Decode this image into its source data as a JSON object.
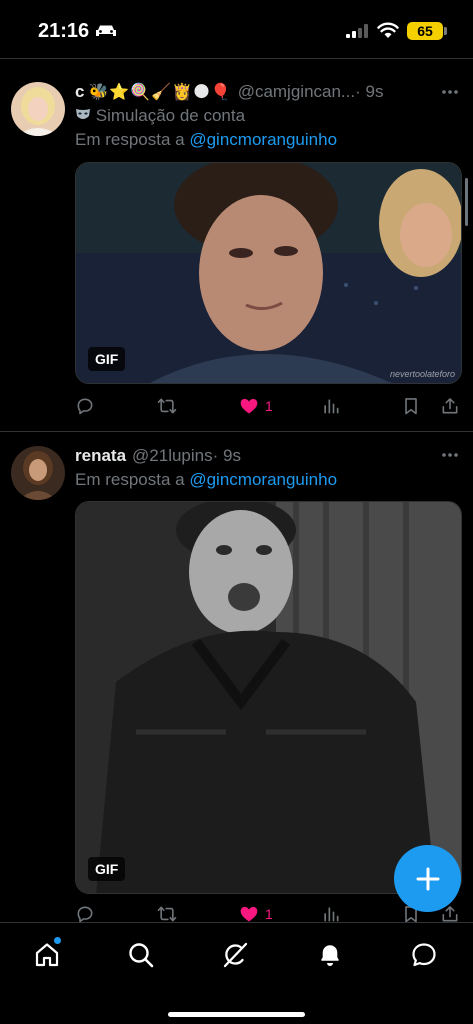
{
  "status_bar": {
    "time": "21:16",
    "battery": "65",
    "icons": [
      "car-icon",
      "cellular-signal-icon",
      "wifi-icon",
      "battery-icon"
    ]
  },
  "tweets": [
    {
      "name": "c",
      "name_emoji": "🐝⭐🍭🧹👸🌑🎈",
      "handle": "@camjgincan...",
      "time": "· 9s",
      "badge_icon": "mask-icon",
      "badge_text": "Simulação de conta",
      "reply_prefix": "Em resposta a",
      "reply_to": "@gincmoranguinho",
      "media_label": "GIF",
      "media_watermark": "nevertoolateforo",
      "likes": "1"
    },
    {
      "name": "renata",
      "handle": "@21lupins",
      "time": "· 9s",
      "reply_prefix": "Em resposta a",
      "reply_to": "@gincmoranguinho",
      "media_label": "GIF",
      "likes": "1"
    }
  ],
  "action_icons": [
    "reply-icon",
    "retweet-icon",
    "like-icon",
    "views-icon",
    "bookmark-icon",
    "share-icon"
  ],
  "fab_icon": "compose-plus-icon",
  "nav": {
    "items": [
      "home-icon",
      "search-icon",
      "grok-icon",
      "notifications-icon",
      "messages-icon"
    ],
    "active": "home-icon",
    "active_indicator_color": "#1d9bf0"
  },
  "colors": {
    "background": "#000000",
    "accent": "#1d9bf0",
    "like": "#f91880",
    "muted": "#71767b",
    "battery": "#f5d000"
  }
}
